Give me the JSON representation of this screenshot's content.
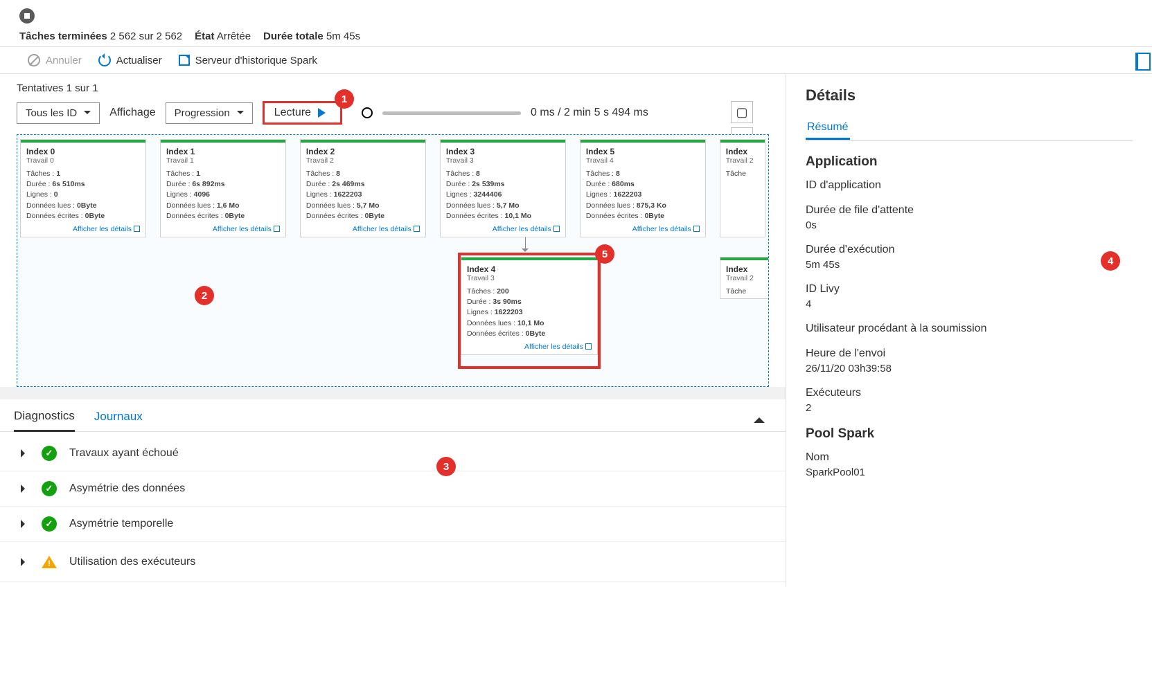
{
  "header": {
    "tasks_label": "Tâches terminées",
    "tasks_value": "2 562 sur 2 562",
    "state_label": "État",
    "state_value": "Arrêtée",
    "duration_label": "Durée totale",
    "duration_value": "5m 45s"
  },
  "actions": {
    "cancel": "Annuler",
    "refresh": "Actualiser",
    "history_server": "Serveur d'historique Spark"
  },
  "attempts": {
    "label": "Tentatives",
    "value": "1 sur 1"
  },
  "controls": {
    "all_ids": "Tous les ID",
    "display_label": "Affichage",
    "progression": "Progression",
    "lecture": "Lecture",
    "slider_text": "0 ms / 2 min 5 s 494 ms"
  },
  "callouts": {
    "c1": "1",
    "c2": "2",
    "c3": "3",
    "c4": "4",
    "c5": "5"
  },
  "field_labels": {
    "tasks": "Tâches :",
    "duration": "Durée :",
    "lines": "Lignes :",
    "data_read": "Données lues :",
    "data_written": "Données écrites :"
  },
  "stages": [
    {
      "title": "Index 0",
      "sub": "Travail 0",
      "tasks": "1",
      "duration": "6s 510ms",
      "lines": "0",
      "read": "0Byte",
      "written": "0Byte"
    },
    {
      "title": "Index 1",
      "sub": "Travail 1",
      "tasks": "1",
      "duration": "6s 892ms",
      "lines": "4096",
      "read": "1,6 Mo",
      "written": "0Byte"
    },
    {
      "title": "Index 2",
      "sub": "Travail 2",
      "tasks": "8",
      "duration": "2s 469ms",
      "lines": "1622203",
      "read": "5,7 Mo",
      "written": "0Byte"
    },
    {
      "title": "Index 3",
      "sub": "Travail 3",
      "tasks": "8",
      "duration": "2s 539ms",
      "lines": "3244406",
      "read": "5,7 Mo",
      "written": "10,1 Mo"
    },
    {
      "title": "Index 5",
      "sub": "Travail 4",
      "tasks": "8",
      "duration": "680ms",
      "lines": "1622203",
      "read": "875,3 Ko",
      "written": "0Byte"
    },
    {
      "title": "Index",
      "sub": "Travail 2",
      "tasks": "",
      "duration": "",
      "lines": "",
      "read": "",
      "written": ""
    }
  ],
  "stage4": {
    "title": "Index 4",
    "sub": "Travail 3",
    "tasks": "200",
    "duration": "3s 90ms",
    "lines": "1622203",
    "read": "10,1 Mo",
    "written": "0Byte"
  },
  "stage_cut2": {
    "title": "Index",
    "sub": "Travail 2",
    "tasks_prefix": "Tâche"
  },
  "details_link": "Afficher les détails",
  "bottom_tabs": {
    "diagnostics": "Diagnostics",
    "logs": "Journaux"
  },
  "diagnostics": [
    {
      "status": "ok",
      "label": "Travaux ayant échoué"
    },
    {
      "status": "ok",
      "label": "Asymétrie des données"
    },
    {
      "status": "ok",
      "label": "Asymétrie temporelle"
    },
    {
      "status": "warn",
      "label": "Utilisation des exécuteurs"
    }
  ],
  "details": {
    "title": "Détails",
    "tab": "Résumé",
    "app_h": "Application",
    "app_id_l": "ID d'application",
    "queue_l": "Durée de file d'attente",
    "queue_v": "0s",
    "exec_dur_l": "Durée d'exécution",
    "exec_dur_v": "5m 45s",
    "livy_l": "ID Livy",
    "livy_v": "4",
    "submit_user_l": "Utilisateur procédant à la soumission",
    "submit_time_l": "Heure de l'envoi",
    "submit_time_v": "26/11/20 03h39:58",
    "executors_l": "Exécuteurs",
    "executors_v": "2",
    "pool_h": "Pool Spark",
    "pool_name_l": "Nom",
    "pool_name_v": "SparkPool01"
  }
}
